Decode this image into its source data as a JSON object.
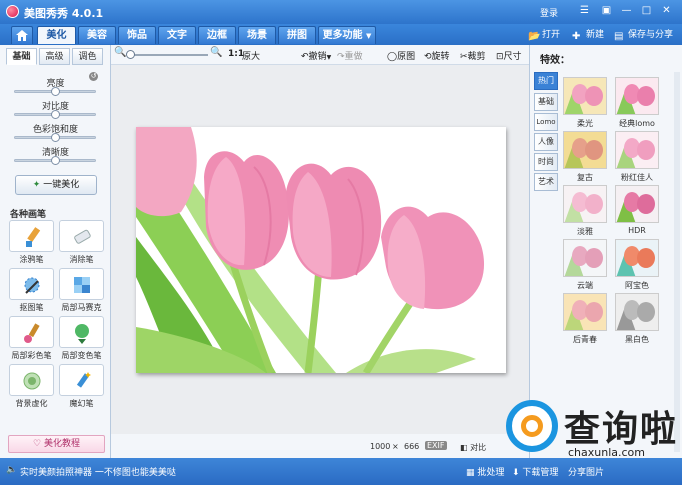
{
  "app": {
    "title": "美图秀秀 4.0.1"
  },
  "titlebar": {
    "login": "登录",
    "open": "打开",
    "new": "新建",
    "save": "保存与分享"
  },
  "tabs": [
    {
      "label": "美化",
      "active": true
    },
    {
      "label": "美容"
    },
    {
      "label": "饰品"
    },
    {
      "label": "文字"
    },
    {
      "label": "边框"
    },
    {
      "label": "场景"
    },
    {
      "label": "拼图"
    },
    {
      "label": "更多功能"
    }
  ],
  "left": {
    "subtabs": [
      "基础",
      "高级",
      "调色"
    ],
    "sliders": [
      {
        "label": "亮度",
        "level": 0.5
      },
      {
        "label": "对比度",
        "level": 0.5
      },
      {
        "label": "色彩饱和度",
        "level": 0.5
      },
      {
        "label": "清晰度",
        "level": 0.5
      }
    ],
    "onekey": "一键美化",
    "section_title": "各种画笔",
    "tools": [
      "涂鸦笔",
      "消除笔",
      "抠图笔",
      "局部马赛克",
      "局部彩色笔",
      "局部变色笔",
      "背景虚化",
      "魔幻笔"
    ],
    "tutorial": "美化教程"
  },
  "toolbar": {
    "ratio": "1:1",
    "original_size": "原大",
    "undo": "撤销",
    "redo": "重做",
    "original": "原图",
    "rotate": "旋转",
    "crop": "裁剪",
    "size": "尺寸"
  },
  "status": {
    "width": "1000",
    "times": "×",
    "height": "666",
    "exif": "EXIF",
    "compare": "对比"
  },
  "right": {
    "title": "特效：",
    "categories": [
      "热门",
      "基础",
      "Lomo",
      "人像",
      "时尚",
      "艺术"
    ],
    "effects": [
      "柔光",
      "经典lomo",
      "复古",
      "粉红佳人",
      "淡雅",
      "HDR",
      "云端",
      "阿宝色",
      "后青春",
      "黑白色"
    ]
  },
  "bottom": {
    "tip": "实时美颜拍照神器 一不修图也能美美哒",
    "batch": "批处理",
    "download": "下载管理",
    "share": "分享图片"
  },
  "watermark": {
    "text": "查询啦",
    "url": "chaxunla.com"
  },
  "colors": {
    "titlebar": "#2d74cb",
    "accent": "#3a82d6",
    "tulip": "#f08bb3"
  }
}
